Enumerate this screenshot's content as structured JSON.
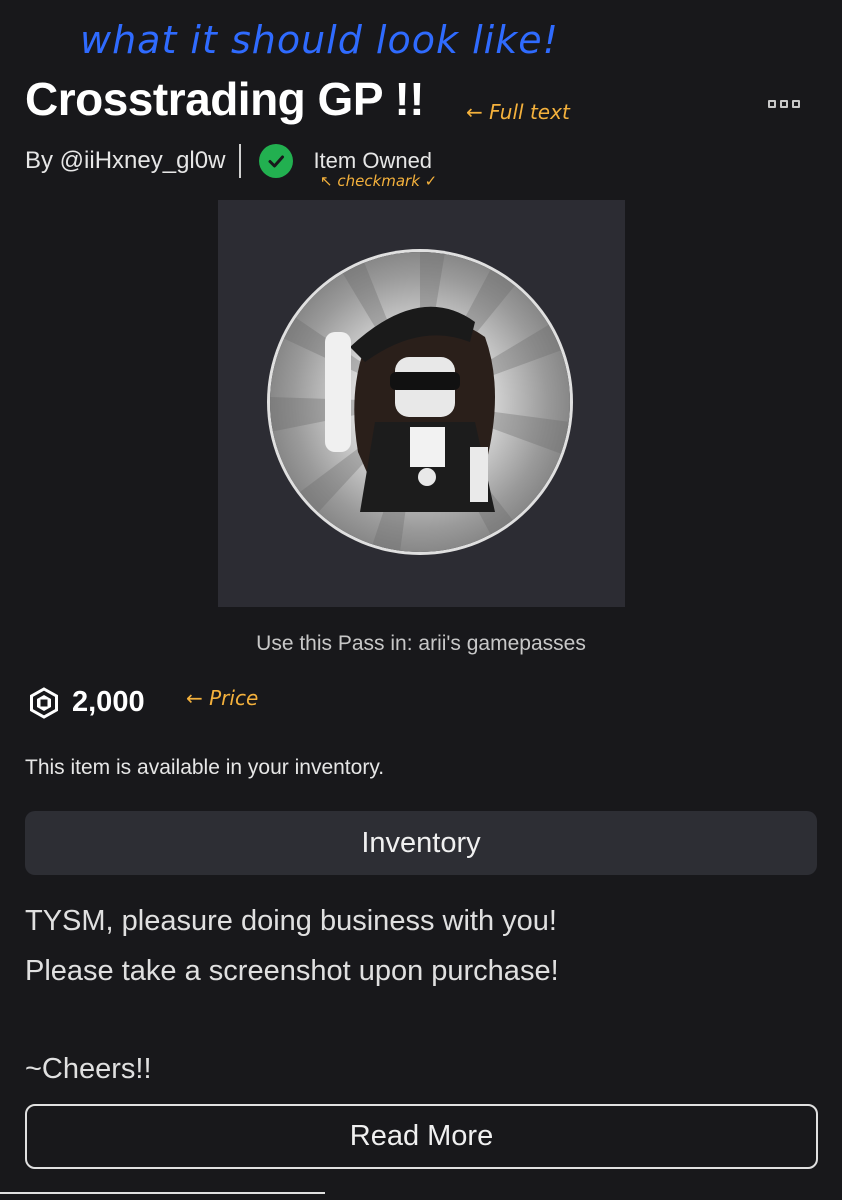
{
  "annotations": {
    "header_note": "what it should look like!",
    "title_note": "← Full text",
    "check_note": "↖ checkmark ✓",
    "price_note": "← Price"
  },
  "item": {
    "title": "Crosstrading GP !!",
    "creator": "By @iiHxney_gl0w",
    "owned_label": "Item Owned",
    "use_pass_text": "Use this Pass in: arii's gamepasses",
    "price": "2,000",
    "availability": "This item is available in your inventory.",
    "inventory_button": "Inventory",
    "description": [
      "TYSM, pleasure doing business with you!",
      "Please take a screenshot upon purchase!",
      "~Cheers!!"
    ],
    "read_more_button": "Read More"
  },
  "icons": {
    "more": "more-options-icon",
    "owned": "checkmark-icon",
    "currency": "robux-icon"
  },
  "colors": {
    "background": "#18181b",
    "owned_badge": "#22b050",
    "annotation_blue": "#2f6bff",
    "annotation_orange": "#f4b13c",
    "button_bg": "#2d2e34"
  }
}
